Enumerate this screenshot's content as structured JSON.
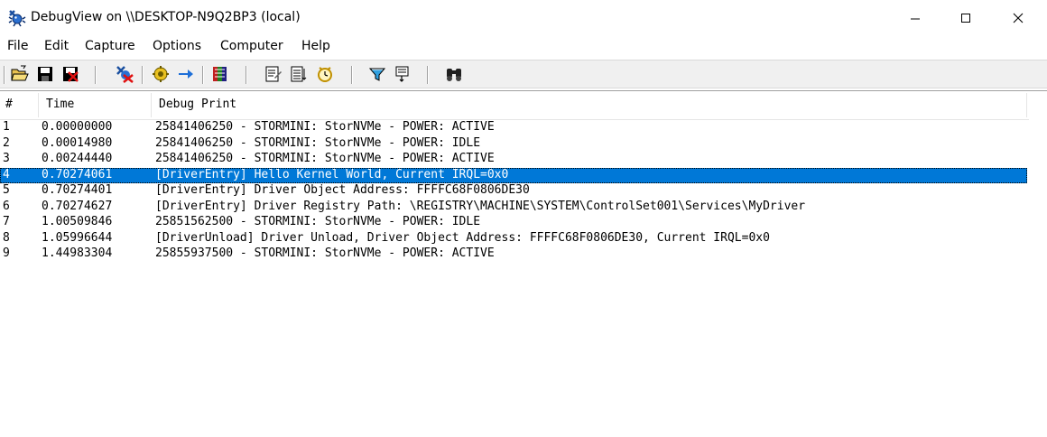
{
  "window": {
    "title": "DebugView on \\\\DESKTOP-N9Q2BP3 (local)"
  },
  "menu": [
    {
      "label": "File"
    },
    {
      "label": "Edit"
    },
    {
      "label": "Capture"
    },
    {
      "label": "Options"
    },
    {
      "label": "Computer"
    },
    {
      "label": "Help"
    }
  ],
  "toolbar": {
    "buttons": [
      "open-icon",
      "save-icon",
      "clear-save-icon",
      "clear-icon",
      "capture-icon",
      "autoscroll-icon",
      "clock-time-icon",
      "history-icon",
      "filter-icon",
      "highlight-icon",
      "find-icon"
    ]
  },
  "columns": {
    "num": "#",
    "time": "Time",
    "text": "Debug Print"
  },
  "selected_row": 4,
  "rows": [
    {
      "num": "1",
      "time": "0.00000000",
      "text": "25841406250 - STORMINI: StorNVMe - POWER: ACTIVE"
    },
    {
      "num": "2",
      "time": "0.00014980",
      "text": "25841406250 - STORMINI: StorNVMe - POWER: IDLE"
    },
    {
      "num": "3",
      "time": "0.00244440",
      "text": "25841406250 - STORMINI: StorNVMe - POWER: ACTIVE"
    },
    {
      "num": "4",
      "time": "0.70274061",
      "text": "[DriverEntry] Hello Kernel World, Current IRQL=0x0"
    },
    {
      "num": "5",
      "time": "0.70274401",
      "text": "[DriverEntry] Driver Object Address: FFFFC68F0806DE30"
    },
    {
      "num": "6",
      "time": "0.70274627",
      "text": "[DriverEntry] Driver Registry Path: \\REGISTRY\\MACHINE\\SYSTEM\\ControlSet001\\Services\\MyDriver"
    },
    {
      "num": "7",
      "time": "1.00509846",
      "text": "25851562500 - STORMINI: StorNVMe - POWER: IDLE"
    },
    {
      "num": "8",
      "time": "1.05996644",
      "text": "[DriverUnload] Driver Unload, Driver Object Address: FFFFC68F0806DE30, Current IRQL=0x0"
    },
    {
      "num": "9",
      "time": "1.44983304",
      "text": "25855937500 - STORMINI: StorNVMe - POWER: ACTIVE"
    }
  ],
  "colors": {
    "selection": "#0078d7",
    "toolbar_bg": "#f0f0f0"
  }
}
